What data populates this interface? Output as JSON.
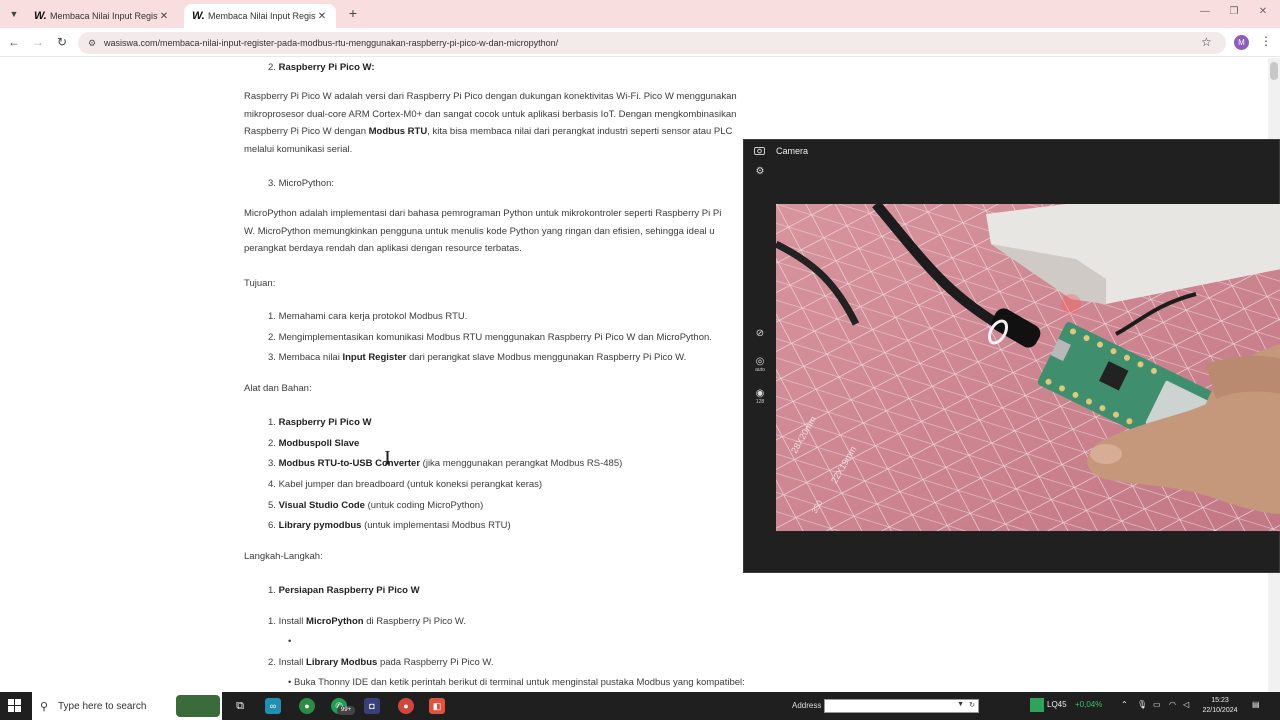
{
  "browser": {
    "tabs": [
      {
        "favicon": "W.",
        "title": "Membaca Nilai Input Register p",
        "close": "✕"
      },
      {
        "favicon": "W.",
        "title": "Membaca Nilai Input Register p",
        "close": "✕"
      }
    ],
    "new_tab": "+",
    "url": "wasiswa.com/membaca-nilai-input-register-pada-modbus-rtu-menggunakan-raspberry-pi-pico-w-dan-micropython/",
    "profile_initial": "M"
  },
  "article": {
    "s2_heading": {
      "num": "2.",
      "title": "Raspberry Pi Pico W:"
    },
    "s2_para": {
      "l1": "Raspberry Pi Pico W adalah versi dari Raspberry Pi Pico dengan dukungan konektivitas Wi-Fi. Pico W menggunakan",
      "l2": "mikroprosesor dual-core ARM Cortex-M0+ dan sangat cocok untuk aplikasi berbasis IoT. Dengan mengkombinasikan",
      "l3a": "Raspberry Pi Pico W dengan ",
      "l3b": "Modbus RTU",
      "l3c": ", kita bisa membaca nilai dari perangkat industri seperti sensor atau PLC",
      "l4": "melalui komunikasi serial."
    },
    "s3_heading": {
      "num": "3.",
      "title": "MicroPython:"
    },
    "s3_para": {
      "l1": "MicroPython adalah implementasi dari bahasa pemrograman Python untuk mikrokontroler seperti Raspberry Pi Pi",
      "l2": "W. MicroPython memungkinkan pengguna untuk menulis kode Python yang ringan dan efisien, sehingga ideal u",
      "l3": "perangkat berdaya rendah dan aplikasi dengan resource terbatas."
    },
    "tujuan": {
      "heading": "Tujuan:",
      "items": [
        {
          "num": "1.",
          "text": "Memahami cara kerja protokol Modbus RTU."
        },
        {
          "num": "2.",
          "text": "Mengimplementasikan komunikasi Modbus RTU menggunakan Raspberry Pi Pico W dan MicroPython."
        },
        {
          "num": "3.",
          "pre": "Membaca nilai ",
          "bold": "Input Register",
          "post": " dari perangkat slave Modbus menggunakan Raspberry Pi Pico W."
        }
      ]
    },
    "alat": {
      "heading": "Alat dan Bahan:",
      "items": [
        {
          "num": "1.",
          "bold": "Raspberry Pi Pico W",
          "post": ""
        },
        {
          "num": "2.",
          "bold": "Modbuspoll Slave",
          "post": ""
        },
        {
          "num": "3.",
          "bold": "Modbus RTU-to-USB Converter",
          "post": " (jika menggunakan perangkat Modbus RS-485)"
        },
        {
          "num": "4.",
          "bold": "",
          "post": "Kabel jumper dan breadboard (untuk koneksi perangkat keras)"
        },
        {
          "num": "5.",
          "bold": "Visual Studio Code",
          "post": " (untuk coding MicroPython)"
        },
        {
          "num": "6.",
          "bold": "Library pymodbus",
          "post": " (untuk implementasi Modbus RTU)"
        }
      ]
    },
    "langkah": {
      "heading": "Langkah-Langkah:",
      "step1": {
        "num": "1.",
        "title": "Persiapan Raspberry Pi Pico W"
      },
      "sub1": {
        "num": "1.",
        "pre": "Install ",
        "bold": "MicroPython",
        "post": " di Raspberry Pi Pico W."
      },
      "bullet_empty": "•",
      "sub2": {
        "num": "2.",
        "pre": "Install ",
        "bold": "Library Modbus",
        "post": " pada Raspberry Pi Pico W."
      },
      "bullet2": {
        "mark": "•",
        "text": "Buka Thonny IDE dan ketik perintah berikut di terminal untuk menginstal pustaka Modbus yang kompatibel:"
      }
    }
  },
  "camera": {
    "title": "Camera",
    "side_labels": {
      "auto": "auto",
      "iso": "128"
    },
    "mat_labels": [
      "28X20mm",
      "22X19mm",
      "350"
    ]
  },
  "taskbar": {
    "search_placeholder": "Type here to search",
    "chat_badge": "99+",
    "address_label": "Address",
    "stock_symbol": "LQ45",
    "stock_change": "+0,04%",
    "time": "15:23",
    "date": "22/10/2024",
    "colors": {
      "stock_up": "#37c26b",
      "accent": "#8e5bbf"
    }
  }
}
